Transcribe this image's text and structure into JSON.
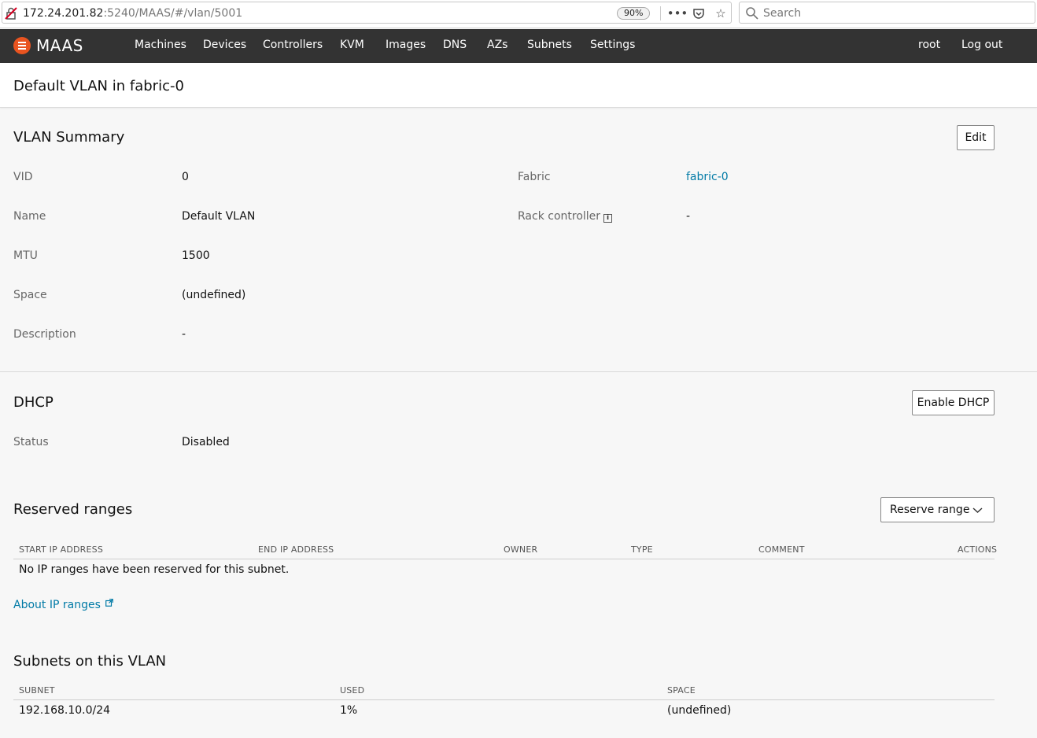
{
  "browser": {
    "url_host": "172.24.201.82",
    "url_rest": ":5240/MAAS/#/vlan/5001",
    "zoom": "90%",
    "search_placeholder": "Search"
  },
  "nav": {
    "brand": "MAAS",
    "items": [
      "Machines",
      "Devices",
      "Controllers",
      "KVM",
      "Images",
      "DNS",
      "AZs",
      "Subnets",
      "Settings"
    ],
    "user": "root",
    "logout": "Log out"
  },
  "page": {
    "title": "Default VLAN in fabric-0"
  },
  "summary": {
    "title": "VLAN Summary",
    "edit_label": "Edit",
    "left_fields": [
      {
        "label": "VID",
        "value": "0"
      },
      {
        "label": "Name",
        "value": "Default VLAN"
      },
      {
        "label": "MTU",
        "value": "1500"
      },
      {
        "label": "Space",
        "value": "(undefined)"
      },
      {
        "label": "Description",
        "value": "-"
      }
    ],
    "fabric_label": "Fabric",
    "fabric_value": "fabric-0",
    "rack_label": "Rack controller",
    "rack_value": "-"
  },
  "dhcp": {
    "title": "DHCP",
    "enable_label": "Enable DHCP",
    "status_label": "Status",
    "status_value": "Disabled"
  },
  "reserved": {
    "title": "Reserved ranges",
    "reserve_label": "Reserve range",
    "columns": [
      "START IP ADDRESS",
      "END IP ADDRESS",
      "OWNER",
      "TYPE",
      "COMMENT",
      "ACTIONS"
    ],
    "empty_message": "No IP ranges have been reserved for this subnet.",
    "about_link": "About IP ranges"
  },
  "subnets": {
    "title": "Subnets on this VLAN",
    "columns": [
      "SUBNET",
      "USED",
      "SPACE"
    ],
    "rows": [
      {
        "subnet": "192.168.10.0/24",
        "used": "1%",
        "space": "(undefined)"
      }
    ]
  },
  "colors": {
    "nav_bg": "#333333",
    "accent": "#e95420",
    "link": "#007aa6"
  }
}
